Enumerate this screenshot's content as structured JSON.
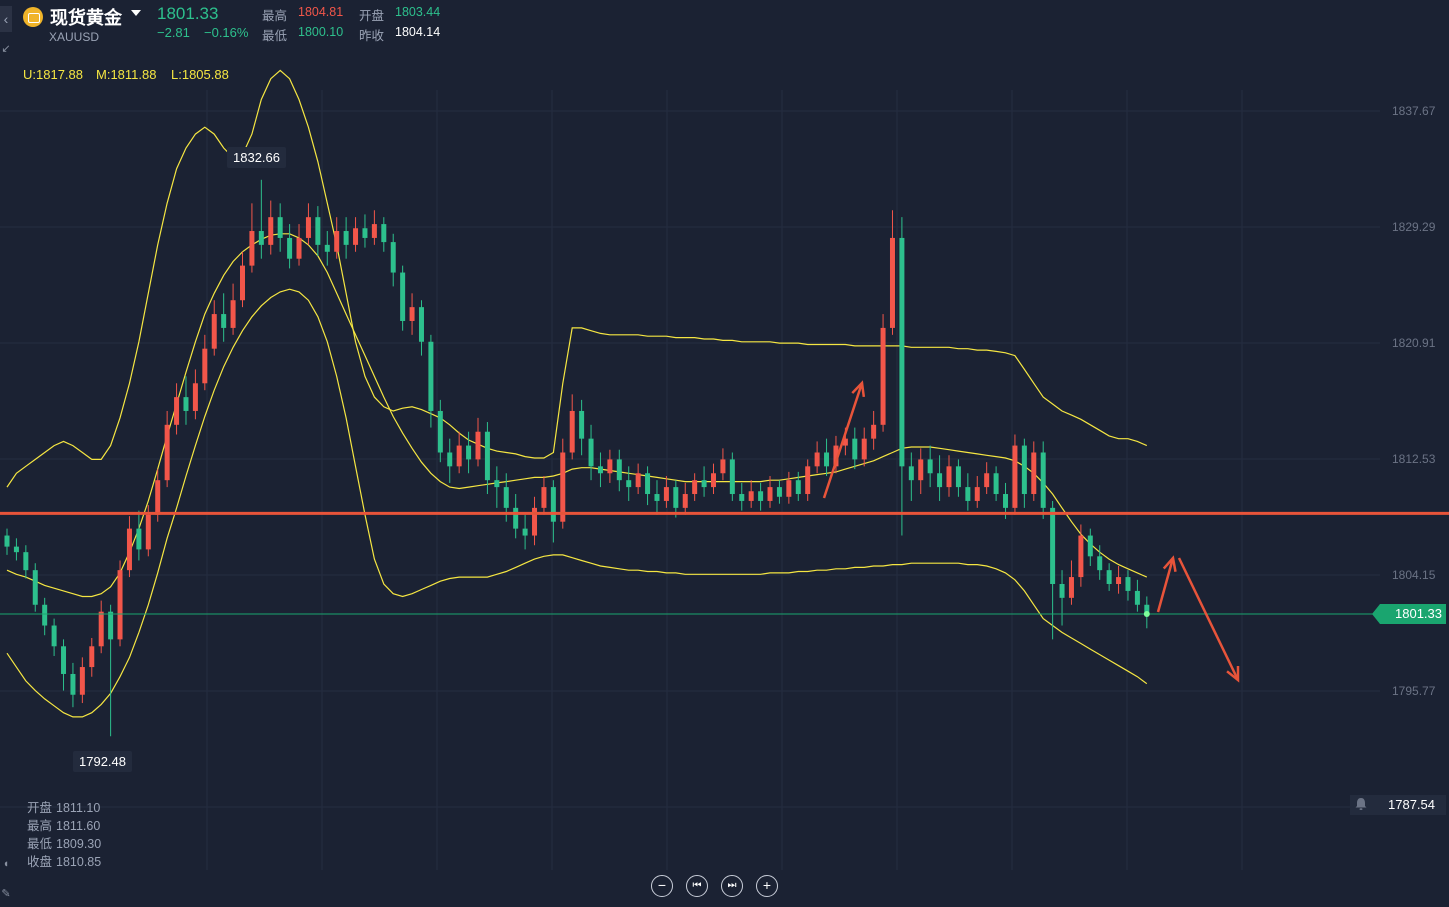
{
  "header": {
    "title": "现货黄金",
    "symbol": "XAUUSD",
    "price": "1801.33",
    "change": "−2.81",
    "change_pct": "−0.16%",
    "high_label": "最高",
    "high_value": "1804.81",
    "open_label": "开盘",
    "open_value": "1803.44",
    "low_label": "最低",
    "low_value": "1800.10",
    "prev_label": "昨收",
    "prev_value": "1804.14"
  },
  "bollinger": {
    "upper": "U:1817.88",
    "middle": "M:1811.88",
    "lower": "L:1805.88"
  },
  "ohlc_panel": {
    "open_label": "开盘",
    "open_value": "1811.10",
    "high_label": "最高",
    "high_value": "1811.60",
    "low_label": "最低",
    "low_value": "1809.30",
    "close_label": "收盘",
    "close_value": "1810.85"
  },
  "price_axis": [
    "1837.67",
    "1829.29",
    "1820.91",
    "1812.53",
    "1804.15",
    "1795.77"
  ],
  "current_price_tag": "1801.33",
  "alert_price": "1787.54",
  "tooltips": {
    "high": "1832.66",
    "low": "1792.48"
  },
  "controls": {
    "zoom_out": "−",
    "prev": "⏮",
    "next": "⏭",
    "zoom_in": "+"
  },
  "colors": {
    "up": "#f2564a",
    "down": "#2dc08d",
    "bollinger": "#f5e642",
    "support_line": "#e8543a",
    "arrow": "#e8543a",
    "background": "#1b2233"
  },
  "chart_data": {
    "type": "candlestick",
    "ylim": [
      1787.54,
      1843
    ],
    "horizontal_line": 1808.6,
    "current_price": 1801.33,
    "candles": [
      [
        1807.0,
        1806.2,
        1807.5,
        1805.6
      ],
      [
        1806.2,
        1805.8,
        1806.8,
        1805.2
      ],
      [
        1805.8,
        1804.5,
        1806.3,
        1803.9
      ],
      [
        1804.5,
        1802.0,
        1805.0,
        1801.5
      ],
      [
        1802.0,
        1800.5,
        1802.5,
        1799.8
      ],
      [
        1800.5,
        1799.0,
        1801.0,
        1798.3
      ],
      [
        1799.0,
        1797.0,
        1799.5,
        1795.8
      ],
      [
        1797.0,
        1795.5,
        1797.8,
        1794.6
      ],
      [
        1795.5,
        1797.5,
        1798.2,
        1794.9
      ],
      [
        1797.5,
        1799.0,
        1799.6,
        1796.8
      ],
      [
        1799.0,
        1801.5,
        1802.3,
        1798.5
      ],
      [
        1801.5,
        1799.5,
        1802.0,
        1792.5
      ],
      [
        1799.5,
        1804.5,
        1805.2,
        1799.0
      ],
      [
        1804.5,
        1807.5,
        1808.4,
        1804.0
      ],
      [
        1807.5,
        1806.0,
        1808.8,
        1805.2
      ],
      [
        1806.0,
        1808.5,
        1809.2,
        1805.5
      ],
      [
        1808.5,
        1811.0,
        1811.8,
        1808.0
      ],
      [
        1811.0,
        1815.0,
        1816.0,
        1810.5
      ],
      [
        1815.0,
        1817.0,
        1818.0,
        1814.3
      ],
      [
        1817.0,
        1816.0,
        1818.5,
        1815.0
      ],
      [
        1816.0,
        1818.0,
        1819.0,
        1815.4
      ],
      [
        1818.0,
        1820.5,
        1821.5,
        1817.5
      ],
      [
        1820.5,
        1823.0,
        1824.0,
        1820.0
      ],
      [
        1823.0,
        1822.0,
        1824.5,
        1821.0
      ],
      [
        1822.0,
        1824.0,
        1825.2,
        1821.5
      ],
      [
        1824.0,
        1826.5,
        1827.5,
        1823.5
      ],
      [
        1826.5,
        1829.0,
        1831.0,
        1826.0
      ],
      [
        1829.0,
        1828.0,
        1832.7,
        1827.0
      ],
      [
        1828.0,
        1830.0,
        1831.2,
        1827.3
      ],
      [
        1830.0,
        1828.5,
        1831.0,
        1827.5
      ],
      [
        1828.5,
        1827.0,
        1829.5,
        1826.3
      ],
      [
        1827.0,
        1828.5,
        1829.5,
        1826.5
      ],
      [
        1828.5,
        1830.0,
        1831.0,
        1828.0
      ],
      [
        1830.0,
        1828.0,
        1830.8,
        1827.2
      ],
      [
        1828.0,
        1827.5,
        1829.0,
        1826.5
      ],
      [
        1827.5,
        1829.0,
        1830.0,
        1827.0
      ],
      [
        1829.0,
        1828.0,
        1830.0,
        1827.0
      ],
      [
        1828.0,
        1829.2,
        1830.0,
        1827.5
      ],
      [
        1829.2,
        1828.5,
        1830.2,
        1827.8
      ],
      [
        1828.5,
        1829.5,
        1830.5,
        1828.0
      ],
      [
        1829.5,
        1828.2,
        1830.0,
        1827.5
      ],
      [
        1828.2,
        1826.0,
        1828.8,
        1825.0
      ],
      [
        1826.0,
        1822.5,
        1826.5,
        1821.8
      ],
      [
        1822.5,
        1823.5,
        1824.5,
        1821.5
      ],
      [
        1823.5,
        1821.0,
        1824.0,
        1820.0
      ],
      [
        1821.0,
        1816.0,
        1821.5,
        1814.8
      ],
      [
        1816.0,
        1813.0,
        1816.8,
        1812.3
      ],
      [
        1813.0,
        1812.0,
        1814.0,
        1810.8
      ],
      [
        1812.0,
        1813.5,
        1814.5,
        1811.5
      ],
      [
        1813.5,
        1812.5,
        1814.5,
        1811.5
      ],
      [
        1812.5,
        1814.5,
        1815.5,
        1812.0
      ],
      [
        1814.5,
        1811.0,
        1815.2,
        1810.0
      ],
      [
        1811.0,
        1810.5,
        1812.0,
        1809.0
      ],
      [
        1810.5,
        1809.0,
        1811.5,
        1808.0
      ],
      [
        1809.0,
        1807.5,
        1810.0,
        1806.8
      ],
      [
        1807.5,
        1807.0,
        1808.5,
        1806.0
      ],
      [
        1807.0,
        1809.0,
        1809.8,
        1806.3
      ],
      [
        1809.0,
        1810.5,
        1811.3,
        1808.5
      ],
      [
        1810.5,
        1808.0,
        1811.0,
        1806.5
      ],
      [
        1808.0,
        1813.0,
        1814.0,
        1807.5
      ],
      [
        1813.0,
        1816.0,
        1817.2,
        1812.5
      ],
      [
        1816.0,
        1814.0,
        1816.8,
        1812.8
      ],
      [
        1814.0,
        1812.0,
        1815.0,
        1811.0
      ],
      [
        1812.0,
        1811.5,
        1813.0,
        1810.5
      ],
      [
        1811.5,
        1812.5,
        1813.2,
        1810.8
      ],
      [
        1812.5,
        1811.0,
        1813.2,
        1810.2
      ],
      [
        1811.0,
        1810.5,
        1812.0,
        1809.5
      ],
      [
        1810.5,
        1811.5,
        1812.2,
        1810.0
      ],
      [
        1811.5,
        1810.0,
        1812.0,
        1809.2
      ],
      [
        1810.0,
        1809.5,
        1811.0,
        1808.5
      ],
      [
        1809.5,
        1810.5,
        1811.3,
        1809.0
      ],
      [
        1810.5,
        1809.0,
        1811.0,
        1808.3
      ],
      [
        1809.0,
        1810.0,
        1810.8,
        1808.5
      ],
      [
        1810.0,
        1811.0,
        1811.5,
        1809.5
      ],
      [
        1811.0,
        1810.5,
        1812.0,
        1809.8
      ],
      [
        1810.5,
        1811.5,
        1812.2,
        1810.0
      ],
      [
        1811.5,
        1812.5,
        1813.3,
        1811.0
      ],
      [
        1812.5,
        1810.0,
        1813.0,
        1809.5
      ],
      [
        1810.0,
        1809.5,
        1810.8,
        1808.8
      ],
      [
        1809.5,
        1810.2,
        1811.0,
        1809.0
      ],
      [
        1810.2,
        1809.5,
        1810.8,
        1808.8
      ],
      [
        1809.5,
        1810.5,
        1811.3,
        1809.0
      ],
      [
        1810.5,
        1809.8,
        1811.0,
        1809.3
      ],
      [
        1809.8,
        1811.0,
        1811.6,
        1809.3
      ],
      [
        1811.0,
        1810.0,
        1811.6,
        1809.5
      ],
      [
        1810.0,
        1812.0,
        1812.5,
        1809.5
      ],
      [
        1812.0,
        1813.0,
        1813.8,
        1811.5
      ],
      [
        1813.0,
        1812.0,
        1814.0,
        1811.3
      ],
      [
        1812.0,
        1813.5,
        1814.2,
        1811.5
      ],
      [
        1813.5,
        1814.0,
        1814.8,
        1812.8
      ],
      [
        1814.0,
        1812.5,
        1814.8,
        1811.8
      ],
      [
        1812.5,
        1814.0,
        1814.8,
        1812.0
      ],
      [
        1814.0,
        1815.0,
        1816.0,
        1813.2
      ],
      [
        1815.0,
        1822.0,
        1823.0,
        1814.5
      ],
      [
        1822.0,
        1828.5,
        1830.5,
        1821.5
      ],
      [
        1828.5,
        1812.0,
        1830.0,
        1807.0
      ],
      [
        1812.0,
        1811.0,
        1813.0,
        1809.5
      ],
      [
        1811.0,
        1812.5,
        1813.3,
        1810.0
      ],
      [
        1812.5,
        1811.5,
        1813.5,
        1810.5
      ],
      [
        1811.5,
        1810.5,
        1812.8,
        1809.5
      ],
      [
        1810.5,
        1812.0,
        1812.8,
        1809.8
      ],
      [
        1812.0,
        1810.5,
        1812.5,
        1809.8
      ],
      [
        1810.5,
        1809.5,
        1811.5,
        1808.8
      ],
      [
        1809.5,
        1810.5,
        1811.3,
        1809.0
      ],
      [
        1810.5,
        1811.5,
        1812.3,
        1810.0
      ],
      [
        1811.5,
        1810.0,
        1812.0,
        1809.5
      ],
      [
        1810.0,
        1809.0,
        1810.8,
        1808.2
      ],
      [
        1809.0,
        1813.5,
        1814.3,
        1808.5
      ],
      [
        1813.5,
        1810.0,
        1814.0,
        1809.0
      ],
      [
        1810.0,
        1813.0,
        1813.8,
        1809.5
      ],
      [
        1813.0,
        1809.0,
        1813.8,
        1808.2
      ],
      [
        1809.0,
        1803.5,
        1809.5,
        1799.5
      ],
      [
        1803.5,
        1802.5,
        1804.5,
        1800.5
      ],
      [
        1802.5,
        1804.0,
        1805.2,
        1802.0
      ],
      [
        1804.0,
        1807.0,
        1807.8,
        1803.3
      ],
      [
        1807.0,
        1805.5,
        1807.5,
        1804.8
      ],
      [
        1805.5,
        1804.5,
        1806.3,
        1803.8
      ],
      [
        1804.5,
        1803.5,
        1805.0,
        1803.0
      ],
      [
        1803.5,
        1804.0,
        1804.8,
        1802.8
      ],
      [
        1804.0,
        1803.0,
        1804.5,
        1802.3
      ],
      [
        1803.0,
        1802.0,
        1803.8,
        1801.5
      ],
      [
        1802.0,
        1801.3,
        1802.6,
        1800.3
      ]
    ],
    "bollinger_upper": [
      1810.5,
      1811.5,
      1812.0,
      1812.5,
      1813.0,
      1813.5,
      1813.8,
      1813.5,
      1813.0,
      1812.5,
      1812.5,
      1813.5,
      1815.5,
      1818.0,
      1821.0,
      1824.5,
      1828.0,
      1831.0,
      1833.5,
      1835.0,
      1836.0,
      1836.5,
      1836.0,
      1835.0,
      1834.3,
      1834.5,
      1836.0,
      1838.5,
      1840.0,
      1840.6,
      1840.0,
      1838.5,
      1836.5,
      1834.0,
      1831.0,
      1828.0,
      1824.5,
      1821.0,
      1818.5,
      1817.0,
      1816.3,
      1816.0,
      1816.2,
      1816.3,
      1816.1,
      1815.8,
      1815.5,
      1815.0,
      1814.4,
      1813.9,
      1813.6,
      1813.3,
      1813.1,
      1813.0,
      1812.9,
      1812.7,
      1812.6,
      1812.6,
      1813.0,
      1818.0,
      1822.0,
      1822.0,
      1821.8,
      1821.6,
      1821.5,
      1821.5,
      1821.5,
      1821.5,
      1821.4,
      1821.4,
      1821.4,
      1821.3,
      1821.3,
      1821.3,
      1821.2,
      1821.2,
      1821.1,
      1821.1,
      1821.0,
      1821.0,
      1821.0,
      1821.0,
      1820.9,
      1820.9,
      1820.9,
      1820.8,
      1820.8,
      1820.8,
      1820.8,
      1820.8,
      1820.7,
      1820.7,
      1820.7,
      1820.7,
      1820.7,
      1820.7,
      1820.6,
      1820.6,
      1820.6,
      1820.6,
      1820.6,
      1820.5,
      1820.5,
      1820.4,
      1820.4,
      1820.3,
      1820.2,
      1820.0,
      1819.0,
      1818.0,
      1817.0,
      1816.5,
      1816.0,
      1815.7,
      1815.4,
      1815.0,
      1814.6,
      1814.2,
      1814.0,
      1814.0,
      1813.8,
      1813.5
    ],
    "bollinger_middle": [
      1804.5,
      1804.2,
      1804.0,
      1803.7,
      1803.4,
      1803.2,
      1803.0,
      1802.8,
      1802.6,
      1802.6,
      1802.8,
      1803.3,
      1804.3,
      1805.8,
      1807.5,
      1809.5,
      1811.8,
      1814.2,
      1816.5,
      1818.8,
      1821.0,
      1823.0,
      1824.5,
      1825.8,
      1826.8,
      1827.5,
      1828.0,
      1828.4,
      1828.7,
      1828.8,
      1828.8,
      1828.5,
      1828.0,
      1827.2,
      1826.0,
      1824.5,
      1823.0,
      1821.5,
      1820.0,
      1818.5,
      1817.0,
      1815.6,
      1814.4,
      1813.3,
      1812.3,
      1811.5,
      1810.9,
      1810.5,
      1810.4,
      1810.5,
      1810.6,
      1810.7,
      1810.8,
      1810.9,
      1811.0,
      1811.1,
      1811.2,
      1811.2,
      1811.3,
      1811.5,
      1811.8,
      1811.9,
      1811.9,
      1811.8,
      1811.7,
      1811.6,
      1811.5,
      1811.4,
      1811.3,
      1811.2,
      1811.1,
      1811.0,
      1810.9,
      1810.9,
      1810.9,
      1810.9,
      1810.9,
      1810.9,
      1810.9,
      1810.9,
      1810.9,
      1811.0,
      1811.0,
      1811.1,
      1811.2,
      1811.3,
      1811.4,
      1811.5,
      1811.6,
      1811.8,
      1812.0,
      1812.2,
      1812.4,
      1812.7,
      1813.0,
      1813.3,
      1813.4,
      1813.4,
      1813.4,
      1813.3,
      1813.2,
      1813.1,
      1813.0,
      1812.9,
      1812.8,
      1812.7,
      1812.6,
      1812.4,
      1812.0,
      1811.5,
      1810.8,
      1810.0,
      1809.0,
      1808.0,
      1807.1,
      1806.4,
      1805.8,
      1805.3,
      1804.9,
      1804.6,
      1804.3,
      1804.0
    ],
    "bollinger_lower": [
      1798.5,
      1797.5,
      1796.5,
      1795.8,
      1795.2,
      1794.7,
      1794.2,
      1793.9,
      1793.9,
      1794.2,
      1794.8,
      1795.6,
      1796.8,
      1798.2,
      1800.0,
      1802.0,
      1804.3,
      1806.8,
      1809.0,
      1811.3,
      1813.5,
      1815.6,
      1817.5,
      1819.2,
      1820.6,
      1821.8,
      1822.8,
      1823.6,
      1824.2,
      1824.6,
      1824.8,
      1824.6,
      1824.0,
      1822.8,
      1821.0,
      1818.5,
      1815.5,
      1812.0,
      1808.5,
      1805.3,
      1803.5,
      1802.8,
      1802.6,
      1802.8,
      1803.1,
      1803.4,
      1803.7,
      1803.9,
      1804.0,
      1804.0,
      1804.0,
      1804.0,
      1804.2,
      1804.4,
      1804.7,
      1805.0,
      1805.3,
      1805.5,
      1805.6,
      1805.6,
      1805.4,
      1805.2,
      1805.0,
      1804.8,
      1804.7,
      1804.6,
      1804.5,
      1804.5,
      1804.4,
      1804.4,
      1804.3,
      1804.3,
      1804.2,
      1804.2,
      1804.2,
      1804.2,
      1804.2,
      1804.2,
      1804.2,
      1804.2,
      1804.2,
      1804.3,
      1804.3,
      1804.3,
      1804.4,
      1804.4,
      1804.5,
      1804.5,
      1804.6,
      1804.6,
      1804.7,
      1804.7,
      1804.8,
      1804.8,
      1804.9,
      1804.9,
      1805.0,
      1805.0,
      1805.0,
      1805.0,
      1805.0,
      1805.0,
      1804.9,
      1804.9,
      1804.8,
      1804.6,
      1804.3,
      1803.8,
      1803.0,
      1802.0,
      1801.0,
      1800.5,
      1800.0,
      1799.6,
      1799.2,
      1798.8,
      1798.4,
      1798.0,
      1797.6,
      1797.2,
      1796.8,
      1796.3
    ]
  }
}
